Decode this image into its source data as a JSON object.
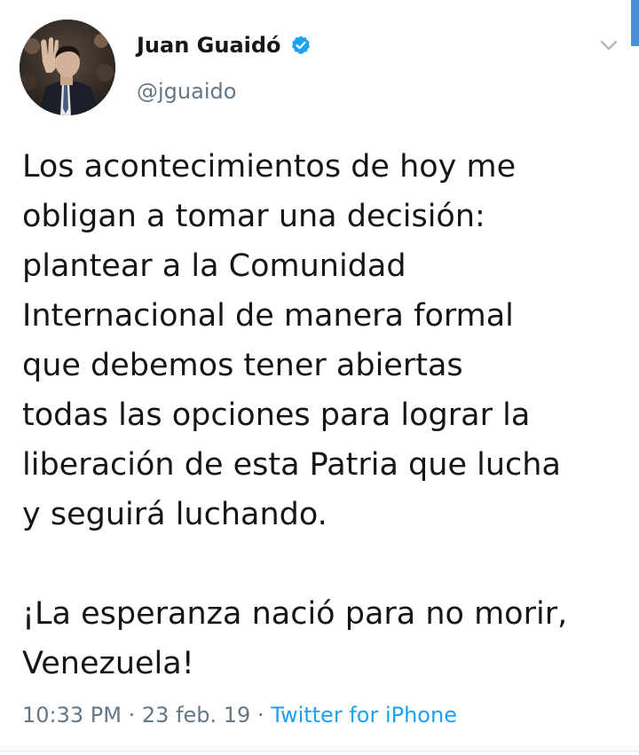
{
  "author": {
    "name": "Juan Guaidó",
    "handle": "@jguaido",
    "verified": true,
    "avatar_icon": "profile-photo"
  },
  "tweet": {
    "lines": [
      "Los acontecimientos de hoy me",
      "obligan a tomar una decisión:",
      "plantear a la Comunidad",
      "Internacional de manera formal",
      "que debemos tener abiertas",
      "todas las opciones para lograr la",
      "liberación de esta Patria que lucha",
      "y seguirá luchando."
    ],
    "closing_lines": [
      "¡La esperanza nació para no morir,",
      "Venezuela!"
    ]
  },
  "meta": {
    "time": "10:33 PM",
    "separator": "·",
    "date": "23 feb. 19",
    "source": "Twitter for iPhone"
  },
  "colors": {
    "text": "#14171a",
    "secondary": "#657786",
    "link": "#1da1f2",
    "verified": "#1da1f2"
  },
  "icons": {
    "verified": "verified-badge-icon",
    "menu": "chevron-down-icon"
  }
}
